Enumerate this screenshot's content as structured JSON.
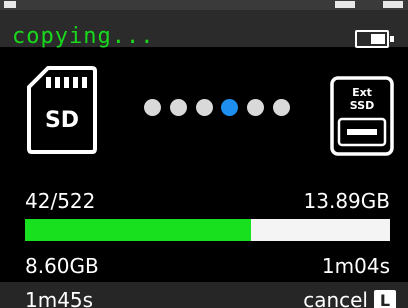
{
  "header": {
    "title": "copying...",
    "battery_level": 0.55
  },
  "transfer": {
    "source_icon": "sd-card-icon",
    "source_label": "SD",
    "dest_icon": "ext-ssd-icon",
    "dest_label_1": "Ext",
    "dest_label_2": "SSD",
    "animation_dots": 6,
    "active_dot": 4
  },
  "stats": {
    "files_count": "42/522",
    "total_size": "13.89GB",
    "copied_size": "8.60GB",
    "elapsed_time": "1m04s",
    "remaining_time": "1m45s",
    "progress": 0.62
  },
  "footer": {
    "cancel_label": "cancel",
    "cancel_key": "L"
  },
  "colors": {
    "title": "#18d91c",
    "progress_fill": "#18e01e",
    "progress_track": "#f4f4f4",
    "active_dot": "#1e8ff0"
  }
}
